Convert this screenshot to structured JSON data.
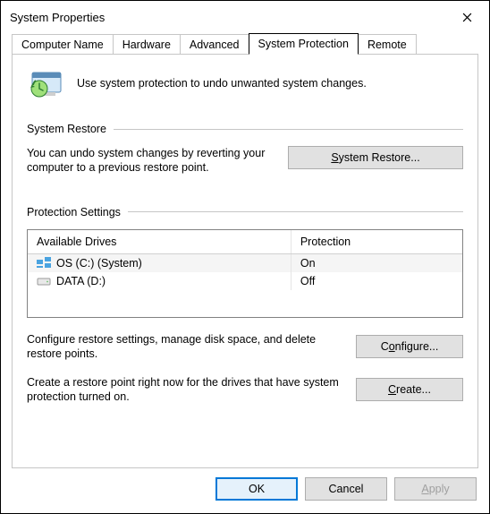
{
  "window": {
    "title": "System Properties"
  },
  "tabs": [
    {
      "label": "Computer Name"
    },
    {
      "label": "Hardware"
    },
    {
      "label": "Advanced"
    },
    {
      "label": "System Protection",
      "active": true
    },
    {
      "label": "Remote"
    }
  ],
  "intro": "Use system protection to undo unwanted system changes.",
  "restore": {
    "heading": "System Restore",
    "text": "You can undo system changes by reverting your computer to a previous restore point.",
    "button": "System Restore..."
  },
  "settings": {
    "heading": "Protection Settings",
    "columns": {
      "drive": "Available Drives",
      "protection": "Protection"
    },
    "drives": [
      {
        "name": "OS (C:) (System)",
        "protection": "On",
        "kind": "system"
      },
      {
        "name": "DATA (D:)",
        "protection": "Off",
        "kind": "data"
      }
    ],
    "configure_text": "Configure restore settings, manage disk space, and delete restore points.",
    "configure_button": "Configure...",
    "create_text": "Create a restore point right now for the drives that have system protection turned on.",
    "create_button": "Create..."
  },
  "footer": {
    "ok": "OK",
    "cancel": "Cancel",
    "apply": "Apply"
  }
}
